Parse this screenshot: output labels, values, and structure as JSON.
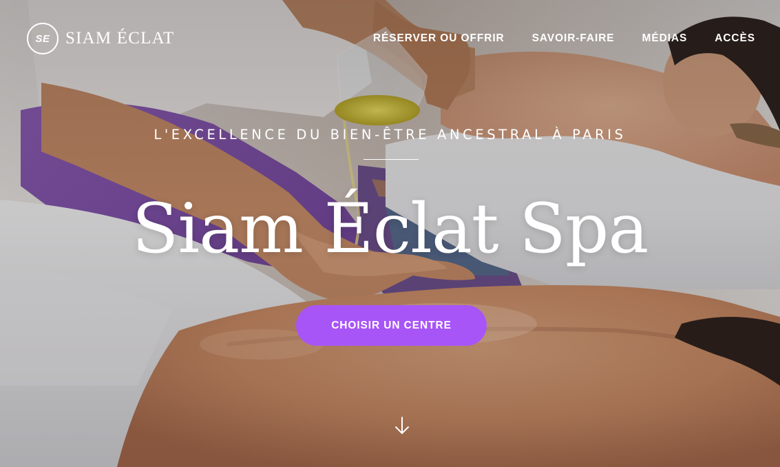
{
  "brand": {
    "monogram": "SE",
    "name": "SIAM ÉCLAT"
  },
  "nav": {
    "items": [
      {
        "label": "RÉSERVER OU OFFRIR"
      },
      {
        "label": "SAVOIR-FAIRE"
      },
      {
        "label": "MÉDIAS"
      },
      {
        "label": "ACCÈS"
      }
    ]
  },
  "hero": {
    "tagline": "L'EXCELLENCE DU BIEN-ÊTRE ANCESTRAL À PARIS",
    "title": "Siam Éclat Spa",
    "cta_label": "CHOISIR UN CENTRE",
    "scroll_icon": "arrow-down-icon",
    "background_image": "spa-massage-photo"
  },
  "colors": {
    "accent": "#a855f7",
    "text": "#ffffff"
  }
}
